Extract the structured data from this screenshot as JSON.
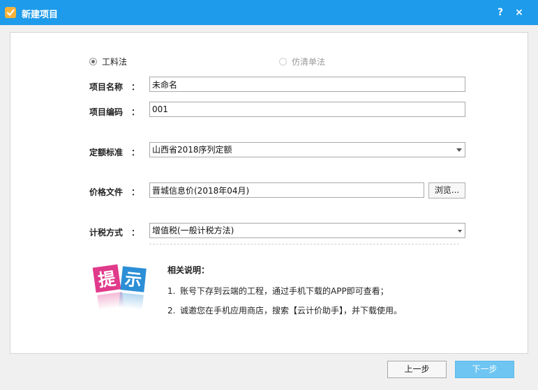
{
  "window": {
    "title": "新建项目",
    "help_label": "?",
    "close_label": "×"
  },
  "method": {
    "options": [
      {
        "label": "工料法",
        "checked": true,
        "enabled": true
      },
      {
        "label": "仿清单法",
        "checked": false,
        "enabled": false
      }
    ]
  },
  "form": {
    "project_name": {
      "label": "项目名称",
      "colon": "：",
      "value": "未命名"
    },
    "project_code": {
      "label": "项目编码",
      "colon": "：",
      "value": "001"
    },
    "quota_standard": {
      "label": "定额标准",
      "colon": "：",
      "value": "山西省2018序列定额"
    },
    "price_file": {
      "label": "价格文件",
      "colon": "：",
      "value": "晋城信息价(2018年04月)",
      "browse_label": "浏览..."
    },
    "tax_method": {
      "label": "计税方式",
      "colon": "：",
      "value": "增值税(一般计税方法)"
    }
  },
  "hint": {
    "logo_text": [
      "提",
      "示"
    ],
    "title": "相关说明：",
    "notes": [
      {
        "num": "1.",
        "text": "账号下存到云端的工程，通过手机下载的APP即可查看；"
      },
      {
        "num": "2.",
        "text": "诚邀您在手机应用商店，搜索【云计价助手】，并下载使用。"
      }
    ]
  },
  "footer": {
    "prev_label": "上一步",
    "next_label": "下一步"
  },
  "colors": {
    "titlebar": "#1e9bea",
    "next_button": "#6ec5f2",
    "logo_pink": "#e03a8a",
    "logo_blue": "#2c8fd6"
  },
  "icons": {
    "app": "app-logo-icon",
    "help": "help-icon",
    "close": "close-icon",
    "dropdown": "chevron-down-icon"
  }
}
